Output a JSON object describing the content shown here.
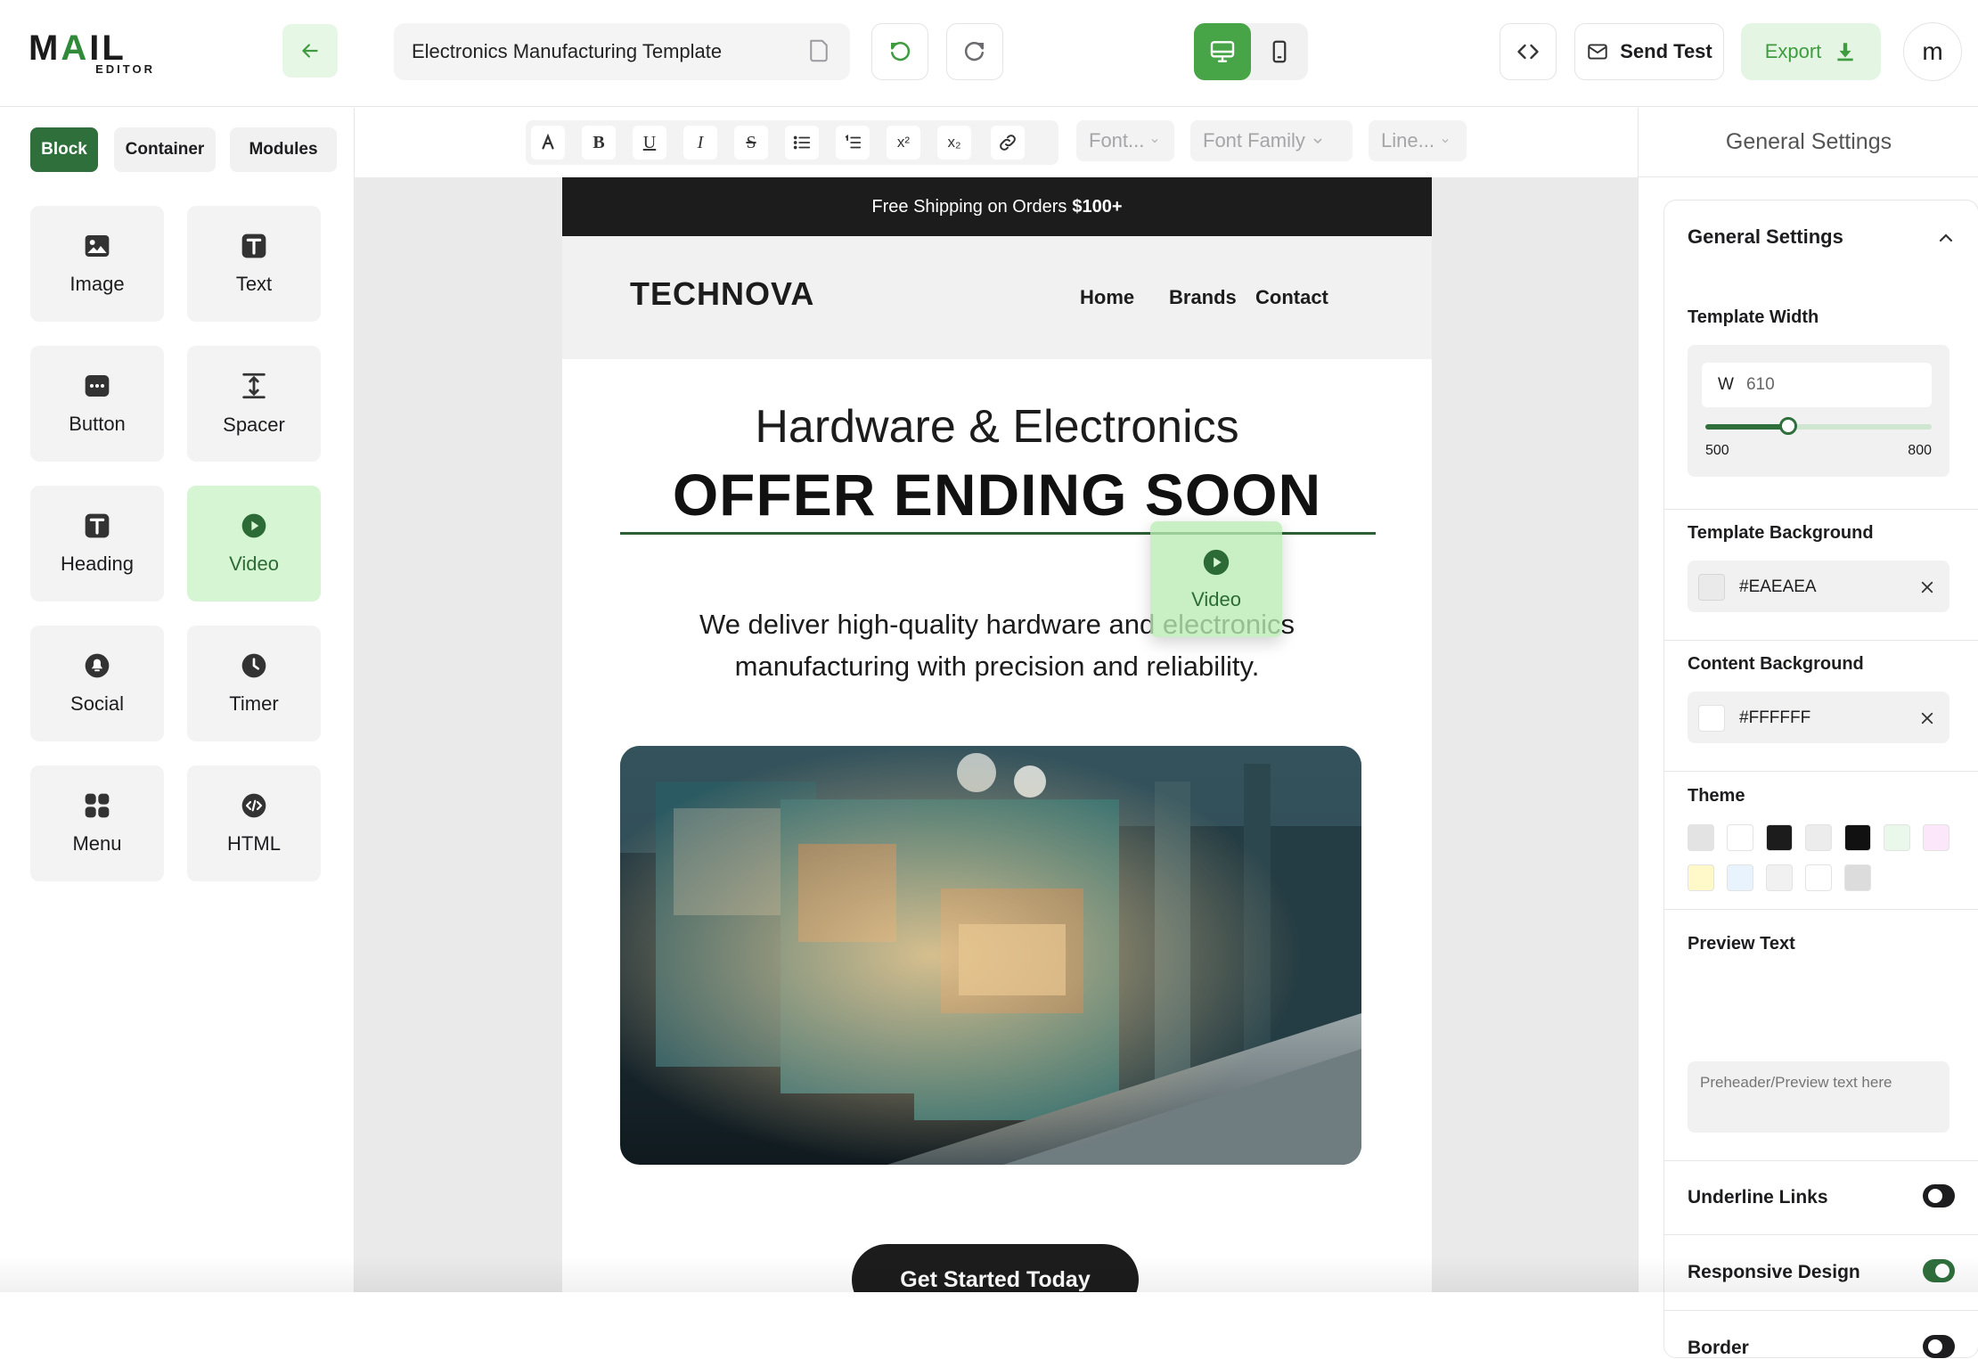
{
  "app": {
    "logo_main": "MAIL",
    "logo_sub": "EDITOR",
    "template_name": "Electronics Manufacturing Template",
    "send_test_label": "Send Test",
    "export_label": "Export",
    "avatar_initial": "m"
  },
  "sidebar": {
    "tabs": [
      {
        "label": "Block",
        "active": true
      },
      {
        "label": "Container",
        "active": false
      },
      {
        "label": "Modules",
        "active": false
      }
    ],
    "blocks": [
      {
        "label": "Image",
        "icon": "image-icon"
      },
      {
        "label": "Text",
        "icon": "text-icon"
      },
      {
        "label": "Button",
        "icon": "button-icon"
      },
      {
        "label": "Spacer",
        "icon": "spacer-icon"
      },
      {
        "label": "Heading",
        "icon": "heading-icon"
      },
      {
        "label": "Video",
        "icon": "video-icon",
        "active": true
      },
      {
        "label": "Social",
        "icon": "social-icon"
      },
      {
        "label": "Timer",
        "icon": "timer-icon"
      },
      {
        "label": "Menu",
        "icon": "menu-grid-icon"
      },
      {
        "label": "HTML",
        "icon": "html-icon"
      }
    ]
  },
  "toolbar": {
    "font_size_placeholder": "Font...",
    "font_family_placeholder": "Font Family",
    "line_height_placeholder": "Line..."
  },
  "email": {
    "shipping_text": "Free Shipping on Orders",
    "shipping_amount": "$100+",
    "brand": "TECHNOVA",
    "nav": [
      "Home",
      "Brands",
      "Contact"
    ],
    "hero_title": "Hardware & Electronics",
    "hero_offer": "OFFER ENDING SOON",
    "hero_description": "We deliver high-quality hardware and electronics manufacturing with precision and reliability.",
    "cta_label": "Get Started Today",
    "drag_ghost_label": "Video"
  },
  "settings": {
    "panel_title": "General Settings",
    "section_title": "General Settings",
    "template_width_label": "Template Width",
    "width_prefix": "W",
    "width_value": "610",
    "width_min": "500",
    "width_max": "800",
    "width_fraction": 0.3667,
    "template_bg_label": "Template Background",
    "template_bg_value": "#EAEAEA",
    "content_bg_label": "Content Background",
    "content_bg_value": "#FFFFFF",
    "theme_label": "Theme",
    "theme_colors": [
      "#e3e3e3",
      "#ffffff",
      "#1c1c1c",
      "#ececec",
      "#111111",
      "#eaf8ec",
      "#fbe6fa",
      "#fff8c8",
      "#e8f3fd",
      "#f1f1f1",
      "#ffffff",
      "#dcdcdc"
    ],
    "preview_text_label": "Preview Text",
    "preview_text_placeholder": "Preheader/Preview text here",
    "toggles": [
      {
        "label": "Underline Links",
        "on": false
      },
      {
        "label": "Responsive Design",
        "on": true
      },
      {
        "label": "Border",
        "on": false
      }
    ]
  },
  "colors": {
    "accent": "#2f6f3c",
    "accent_light": "#d5f5d3",
    "canvas_bg": "#EAEAEA",
    "dark": "#1c1c1c"
  }
}
